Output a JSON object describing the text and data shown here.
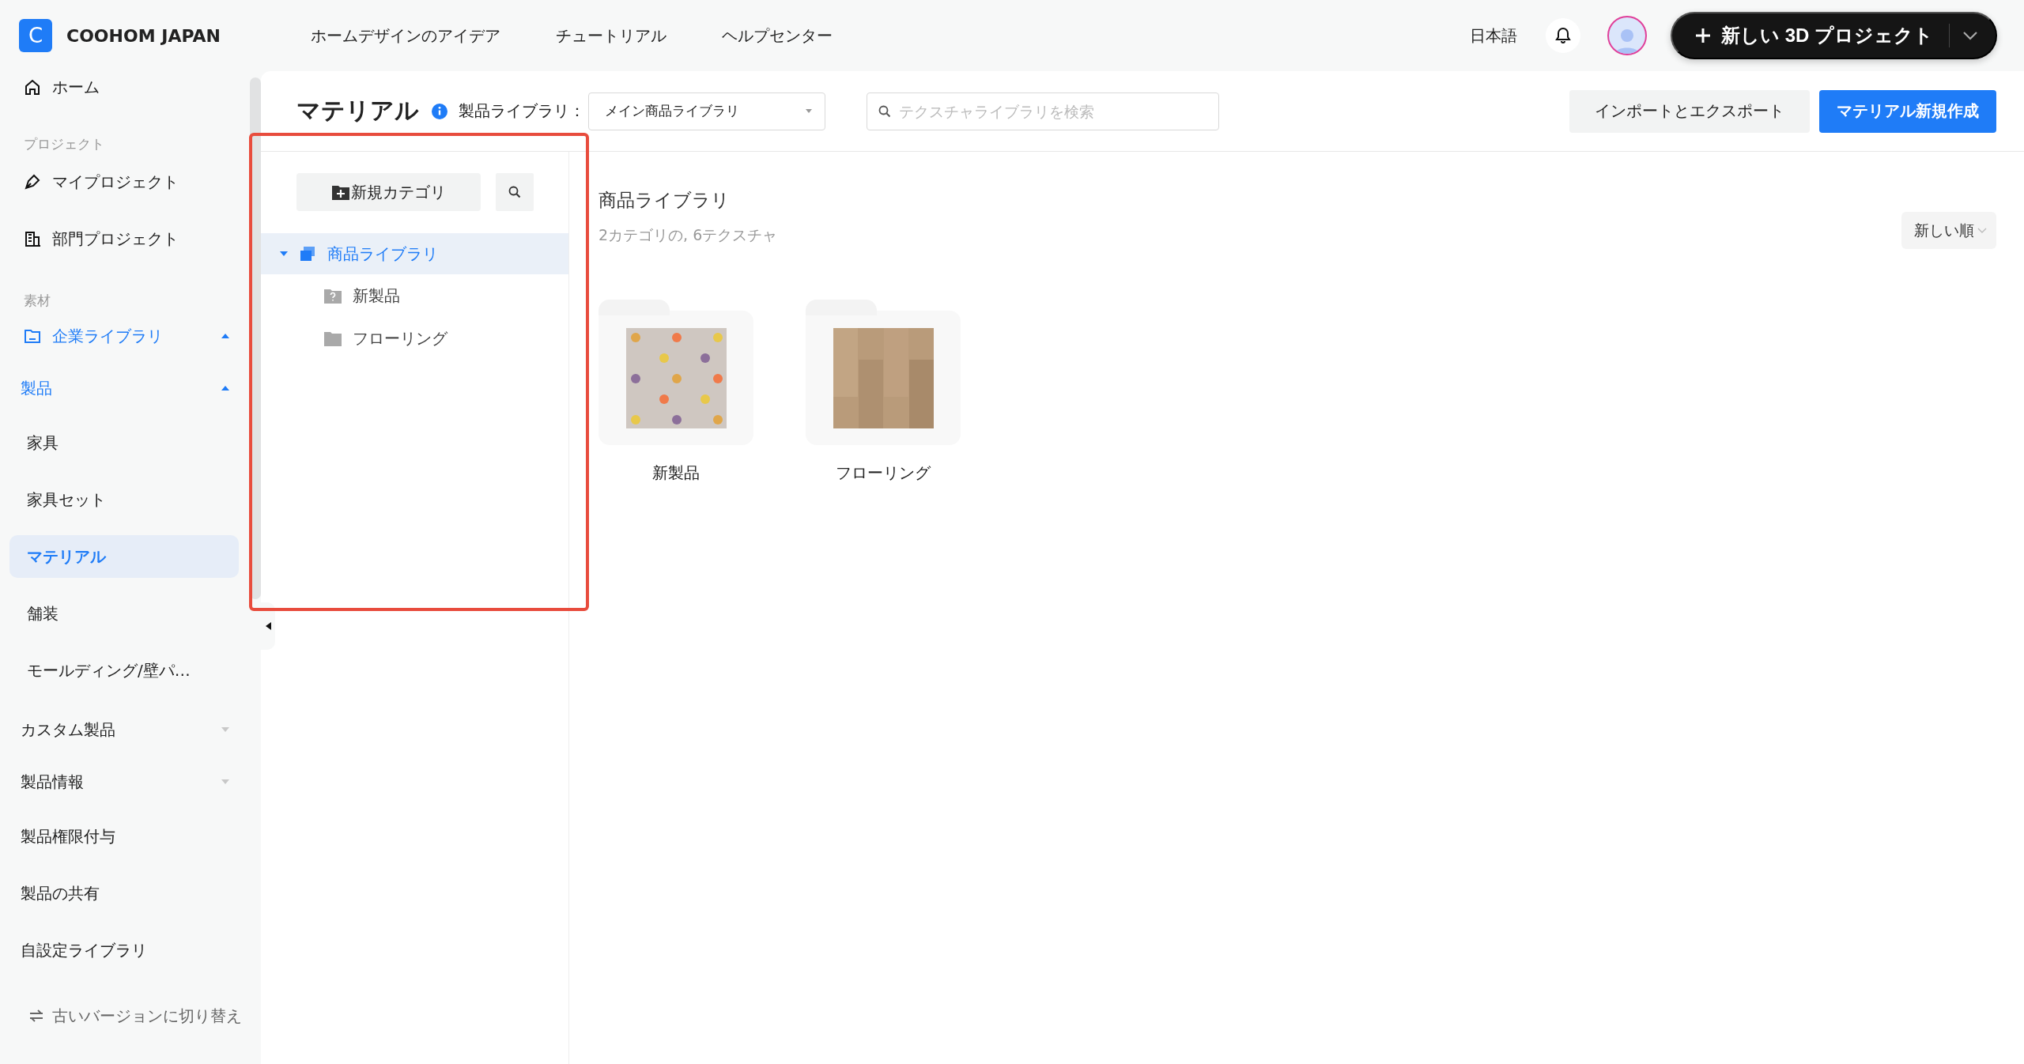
{
  "header": {
    "logo_letter": "C",
    "brand": "COOHOM JAPAN",
    "nav": [
      {
        "label": "ホームデザインのアイデア"
      },
      {
        "label": "チュートリアル"
      },
      {
        "label": "ヘルプセンター"
      }
    ],
    "language": "日本語",
    "new_project_button": "新しい 3D プロジェクト"
  },
  "sidebar": {
    "items": [
      {
        "kind": "link",
        "label": "ホーム",
        "selected": false
      },
      {
        "kind": "heading",
        "label": "プロジェクト"
      },
      {
        "kind": "link",
        "label": "マイプロジェクト",
        "selected": false
      },
      {
        "kind": "link",
        "label": "部門プロジェクト",
        "selected": false
      },
      {
        "kind": "heading",
        "label": "素材"
      },
      {
        "kind": "group",
        "label": "企業ライブラリ",
        "expanded": true,
        "children": [
          {
            "kind": "group",
            "label": "製品",
            "expanded": true,
            "children": [
              {
                "kind": "item",
                "label": "家具",
                "selected": false
              },
              {
                "kind": "item",
                "label": "家具セット",
                "selected": false
              },
              {
                "kind": "item",
                "label": "マテリアル",
                "selected": true
              },
              {
                "kind": "item",
                "label": "舗装",
                "selected": false
              },
              {
                "kind": "item",
                "label": "モールディング/壁パ…",
                "selected": false
              }
            ]
          },
          {
            "kind": "group",
            "label": "カスタム製品",
            "expanded": false
          },
          {
            "kind": "group",
            "label": "製品情報",
            "expanded": false
          },
          {
            "kind": "item",
            "label": "製品権限付与",
            "selected": false
          },
          {
            "kind": "item",
            "label": "製品の共有",
            "selected": false
          },
          {
            "kind": "item",
            "label": "自設定ライブラリ",
            "selected": false
          }
        ]
      }
    ],
    "footer": "古いバージョンに切り替え"
  },
  "main": {
    "title": "マテリアル",
    "library_label": "製品ライブラリ：",
    "library_select": {
      "value": "メイン商品ライブラリ"
    },
    "search": {
      "placeholder": "テクスチャライブラリを検索"
    },
    "buttons": [
      {
        "label": "インポートとエクスポート",
        "kind": "secondary"
      },
      {
        "label": "マテリアル新規作成",
        "kind": "primary"
      }
    ],
    "tree_panel": {
      "new_category_button": "新規カテゴリ",
      "tree": [
        {
          "label": "商品ライブラリ",
          "expanded": true,
          "selected": true,
          "children": [
            {
              "label": "新製品",
              "kind": "unsorted",
              "selected": false
            },
            {
              "label": "フローリング",
              "kind": "folder",
              "selected": false
            }
          ]
        }
      ]
    },
    "content": {
      "heading": "商品ライブラリ",
      "summary": "2カテゴリの, 6テクスチャ",
      "sort_button": "新しい順",
      "folders": [
        {
          "label": "新製品"
        },
        {
          "label": "フローリング"
        }
      ]
    }
  }
}
